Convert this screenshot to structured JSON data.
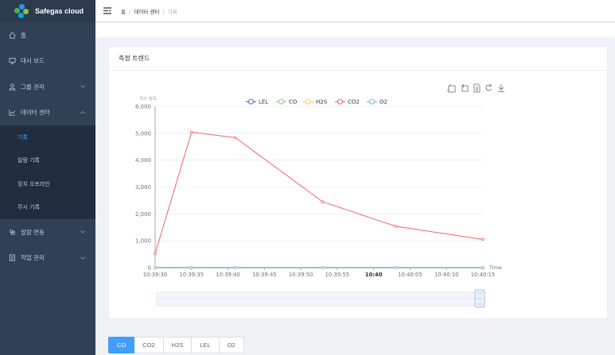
{
  "app": {
    "title": "Safegas cloud"
  },
  "sidebar": {
    "items": [
      {
        "label": "홈",
        "icon": "home-icon"
      },
      {
        "label": "대시 보드",
        "icon": "monitor-icon"
      },
      {
        "label": "그룹 관리",
        "icon": "group-icon",
        "expandable": true
      },
      {
        "label": "데이터 센터",
        "icon": "line-chart-icon",
        "expandable": true,
        "expanded": true
      },
      {
        "label": "알람 연동",
        "icon": "link-icon",
        "expandable": true
      },
      {
        "label": "작업 관리",
        "icon": "list-icon",
        "expandable": true
      }
    ],
    "subitems": [
      {
        "label": "기록",
        "active": true
      },
      {
        "label": "알람 기록"
      },
      {
        "label": "장치 오프라인"
      },
      {
        "label": "무시 기록"
      }
    ]
  },
  "breadcrumb": {
    "home": "홈",
    "sep": "/",
    "section": "데이터 센터",
    "current": "기록"
  },
  "card": {
    "title": "측정 트렌드"
  },
  "chart_data": {
    "type": "line",
    "ylabel": "가스 농도",
    "xlabel": "Time",
    "ylim": [
      0,
      6000
    ],
    "yticks": [
      "0",
      "1,000",
      "2,000",
      "3,000",
      "4,000",
      "5,000",
      "6,000"
    ],
    "xticks": [
      "10:39:30",
      "10:39:35",
      "10:39:40",
      "10:39:45",
      "10:39:50",
      "10:39:55",
      "10:40",
      "10:40:05",
      "10:40:10",
      "10:40:15"
    ],
    "xlim": [
      "10:39:30",
      "10:40:15"
    ],
    "legend_position": "top-center",
    "series": [
      {
        "name": "LEL",
        "color": "#5470c6",
        "x": [
          "10:39:30",
          "10:39:35",
          "10:39:41",
          "10:39:53",
          "10:40:03",
          "10:40:15"
        ],
        "values": [
          0,
          0,
          0,
          0,
          0,
          0
        ]
      },
      {
        "name": "CO",
        "color": "#91cc75",
        "x": [
          "10:39:30",
          "10:39:35",
          "10:39:41",
          "10:39:53",
          "10:40:03",
          "10:40:15"
        ],
        "values": [
          0,
          0,
          0,
          0,
          0,
          0
        ]
      },
      {
        "name": "H2S",
        "color": "#fac858",
        "x": [
          "10:39:30",
          "10:39:35",
          "10:39:41",
          "10:39:53",
          "10:40:03",
          "10:40:15"
        ],
        "values": [
          0,
          0,
          0,
          0,
          0,
          0
        ]
      },
      {
        "name": "CO2",
        "color": "#ee6666",
        "x": [
          "10:39:30",
          "10:39:35",
          "10:39:41",
          "10:39:53",
          "10:40:03",
          "10:40:15"
        ],
        "values": [
          520,
          5040,
          4840,
          2450,
          1540,
          1050
        ]
      },
      {
        "name": "O2",
        "color": "#73c0de",
        "x": [
          "10:39:30",
          "10:39:35",
          "10:39:41",
          "10:39:53",
          "10:40:03",
          "10:40:15"
        ],
        "values": [
          0,
          0,
          0,
          0,
          0,
          0
        ]
      }
    ],
    "toolbox": [
      "zoom-select-icon",
      "zoom-reset-icon",
      "data-view-icon",
      "restore-icon",
      "download-icon"
    ]
  },
  "tabs": [
    {
      "label": "CO",
      "active": true
    },
    {
      "label": "CO2"
    },
    {
      "label": "H2S"
    },
    {
      "label": "LEL"
    },
    {
      "label": "O2"
    }
  ]
}
